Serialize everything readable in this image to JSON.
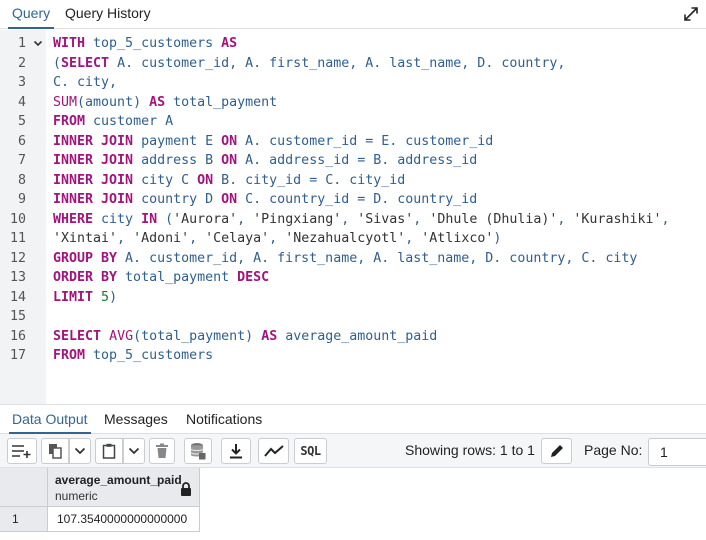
{
  "top_tabs": [
    {
      "label": "Query",
      "active": true
    },
    {
      "label": "Query History",
      "active": false
    }
  ],
  "editor": {
    "lines": [
      {
        "n": "1",
        "fold": true,
        "tokens": [
          [
            "kw",
            "WITH"
          ],
          [
            "plain",
            " top_5_customers "
          ],
          [
            "kw",
            "AS"
          ]
        ]
      },
      {
        "n": "2",
        "tokens": [
          [
            "plain",
            "("
          ],
          [
            "kw",
            "SELECT"
          ],
          [
            "plain",
            " A. customer_id, A. first_name, A. last_name, D. country,"
          ]
        ]
      },
      {
        "n": "3",
        "tokens": [
          [
            "plain",
            "C. city,"
          ]
        ]
      },
      {
        "n": "4",
        "tokens": [
          [
            "fn",
            "SUM"
          ],
          [
            "plain",
            "(amount) "
          ],
          [
            "kw",
            "AS"
          ],
          [
            "plain",
            " total_payment"
          ]
        ]
      },
      {
        "n": "5",
        "tokens": [
          [
            "kw",
            "FROM"
          ],
          [
            "plain",
            " customer A"
          ]
        ]
      },
      {
        "n": "6",
        "tokens": [
          [
            "kw",
            "INNER JOIN"
          ],
          [
            "plain",
            " payment E "
          ],
          [
            "kw",
            "ON"
          ],
          [
            "plain",
            " A. customer_id = E. customer_id"
          ]
        ]
      },
      {
        "n": "7",
        "tokens": [
          [
            "kw",
            "INNER JOIN"
          ],
          [
            "plain",
            " address B "
          ],
          [
            "kw",
            "ON"
          ],
          [
            "plain",
            " A. address_id = B. address_id"
          ]
        ]
      },
      {
        "n": "8",
        "tokens": [
          [
            "kw",
            "INNER JOIN"
          ],
          [
            "plain",
            " city C "
          ],
          [
            "kw",
            "ON"
          ],
          [
            "plain",
            " B. city_id = C. city_id"
          ]
        ]
      },
      {
        "n": "9",
        "tokens": [
          [
            "kw",
            "INNER JOIN"
          ],
          [
            "plain",
            " country D "
          ],
          [
            "kw",
            "ON"
          ],
          [
            "plain",
            " C. country_id = D. country_id"
          ]
        ]
      },
      {
        "n": "10",
        "tokens": [
          [
            "kw",
            "WHERE"
          ],
          [
            "plain",
            " city "
          ],
          [
            "kw",
            "IN"
          ],
          [
            "plain",
            " ("
          ],
          [
            "str",
            "'Aurora'"
          ],
          [
            "plain",
            ", "
          ],
          [
            "str",
            "'Pingxiang'"
          ],
          [
            "plain",
            ", "
          ],
          [
            "str",
            "'Sivas'"
          ],
          [
            "plain",
            ", "
          ],
          [
            "str",
            "'Dhule (Dhulia)'"
          ],
          [
            "plain",
            ", "
          ],
          [
            "str",
            "'Kurashiki'"
          ],
          [
            "plain",
            ","
          ]
        ]
      },
      {
        "n": "11",
        "tokens": [
          [
            "str",
            "'Xintai'"
          ],
          [
            "plain",
            ", "
          ],
          [
            "str",
            "'Adoni'"
          ],
          [
            "plain",
            ", "
          ],
          [
            "str",
            "'Celaya'"
          ],
          [
            "plain",
            ", "
          ],
          [
            "str",
            "'Nezahualcyotl'"
          ],
          [
            "plain",
            ", "
          ],
          [
            "str",
            "'Atlixco'"
          ],
          [
            "plain",
            ")"
          ]
        ]
      },
      {
        "n": "12",
        "tokens": [
          [
            "kw",
            "GROUP BY"
          ],
          [
            "plain",
            " A. customer_id, A. first_name, A. last_name, D. country, C. city"
          ]
        ]
      },
      {
        "n": "13",
        "tokens": [
          [
            "kw",
            "ORDER BY"
          ],
          [
            "plain",
            " total_payment "
          ],
          [
            "kw",
            "DESC"
          ]
        ]
      },
      {
        "n": "14",
        "tokens": [
          [
            "kw",
            "LIMIT"
          ],
          [
            "plain",
            " "
          ],
          [
            "num",
            "5"
          ],
          [
            "plain",
            ")"
          ]
        ]
      },
      {
        "n": "15",
        "tokens": []
      },
      {
        "n": "16",
        "tokens": [
          [
            "kw",
            "SELECT"
          ],
          [
            "plain",
            " "
          ],
          [
            "fn",
            "AVG"
          ],
          [
            "plain",
            "(total_payment) "
          ],
          [
            "kw",
            "AS"
          ],
          [
            "plain",
            " average_amount_paid"
          ]
        ]
      },
      {
        "n": "17",
        "tokens": [
          [
            "kw",
            "FROM"
          ],
          [
            "plain",
            " top_5_customers"
          ]
        ]
      }
    ]
  },
  "result_tabs": [
    {
      "label": "Data Output",
      "active": true
    },
    {
      "label": "Messages",
      "active": false
    },
    {
      "label": "Notifications",
      "active": false
    }
  ],
  "toolbar": {
    "sql_label": "SQL",
    "rows_label": "Showing rows: 1 to 1",
    "page_label": "Page No:",
    "page_value": "1"
  },
  "grid": {
    "column": {
      "name": "average_amount_paid",
      "type": "numeric"
    },
    "rows": [
      {
        "num": "1",
        "value": "107.3540000000000000"
      }
    ]
  },
  "colors": {
    "accent": "#326690",
    "keyword": "#a3137d",
    "identifier": "#2f5f8f",
    "number": "#117733"
  }
}
